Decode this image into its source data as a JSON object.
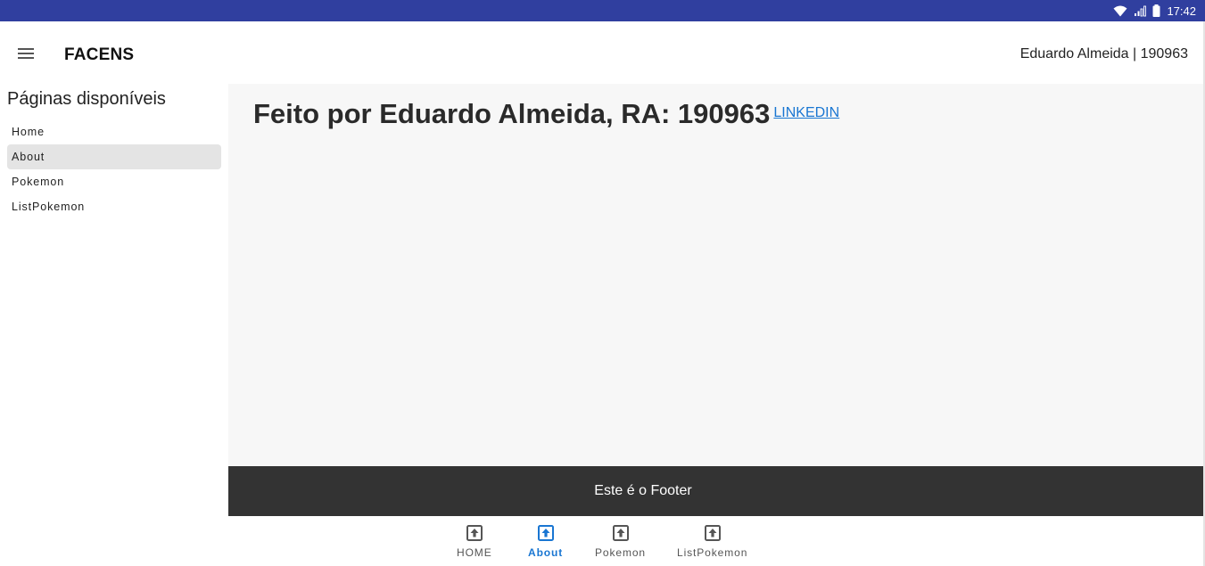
{
  "status_bar": {
    "time": "17:42",
    "icons": [
      "wifi-icon",
      "signal-icon",
      "battery-icon"
    ]
  },
  "app_bar": {
    "menu_icon": "menu-icon",
    "title": "FACENS",
    "user_info": "Eduardo Almeida | 190963"
  },
  "sidebar": {
    "title": "Páginas disponíveis",
    "items": [
      {
        "label": "Home",
        "active": false
      },
      {
        "label": "About",
        "active": true
      },
      {
        "label": "Pokemon",
        "active": false
      },
      {
        "label": "ListPokemon",
        "active": false
      }
    ]
  },
  "main": {
    "heading": "Feito por Eduardo Almeida, RA: 190963",
    "link_label": "LINKEDIN"
  },
  "footer": {
    "text": "Este é o Footer"
  },
  "bottom_nav": {
    "items": [
      {
        "label": "HOME",
        "icon": "upload-box-icon",
        "active": false
      },
      {
        "label": "About",
        "icon": "upload-box-icon",
        "active": true
      },
      {
        "label": "Pokemon",
        "icon": "upload-box-icon",
        "active": false
      },
      {
        "label": "ListPokemon",
        "icon": "upload-box-icon",
        "active": false
      }
    ]
  },
  "colors": {
    "status_bar": "#303f9f",
    "accent": "#1976d2",
    "footer": "#333333",
    "content_bg": "#f7f7f7",
    "active_item_bg": "#e4e4e4"
  }
}
